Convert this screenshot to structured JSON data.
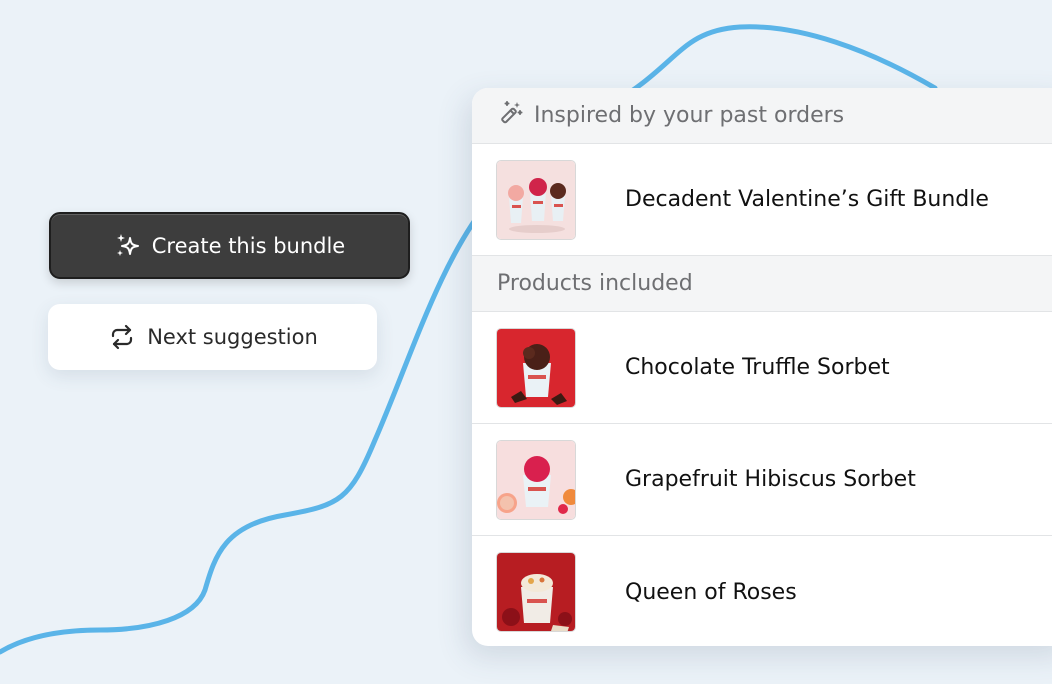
{
  "actions": {
    "create_label": "Create this bundle",
    "create_icon": "sparkles-icon",
    "next_label": "Next suggestion",
    "next_icon": "repeat-icon"
  },
  "panel": {
    "header_icon": "magic-wand-icon",
    "header_text": "Inspired by your past orders",
    "bundle": {
      "name": "Decadent Valentine’s Gift Bundle",
      "image": "bundle-product-image"
    },
    "products_heading": "Products included",
    "products": [
      {
        "name": "Chocolate Truffle Sorbet",
        "image": "chocolate-sorbet-image"
      },
      {
        "name": "Grapefruit Hibiscus Sorbet",
        "image": "grapefruit-sorbet-image"
      },
      {
        "name": "Queen of Roses",
        "image": "queen-of-roses-image"
      }
    ]
  },
  "colors": {
    "background": "#ebf2f8",
    "curve": "#5ab4e8",
    "primary_button": "#3d3d3d",
    "secondary_button": "#ffffff"
  }
}
